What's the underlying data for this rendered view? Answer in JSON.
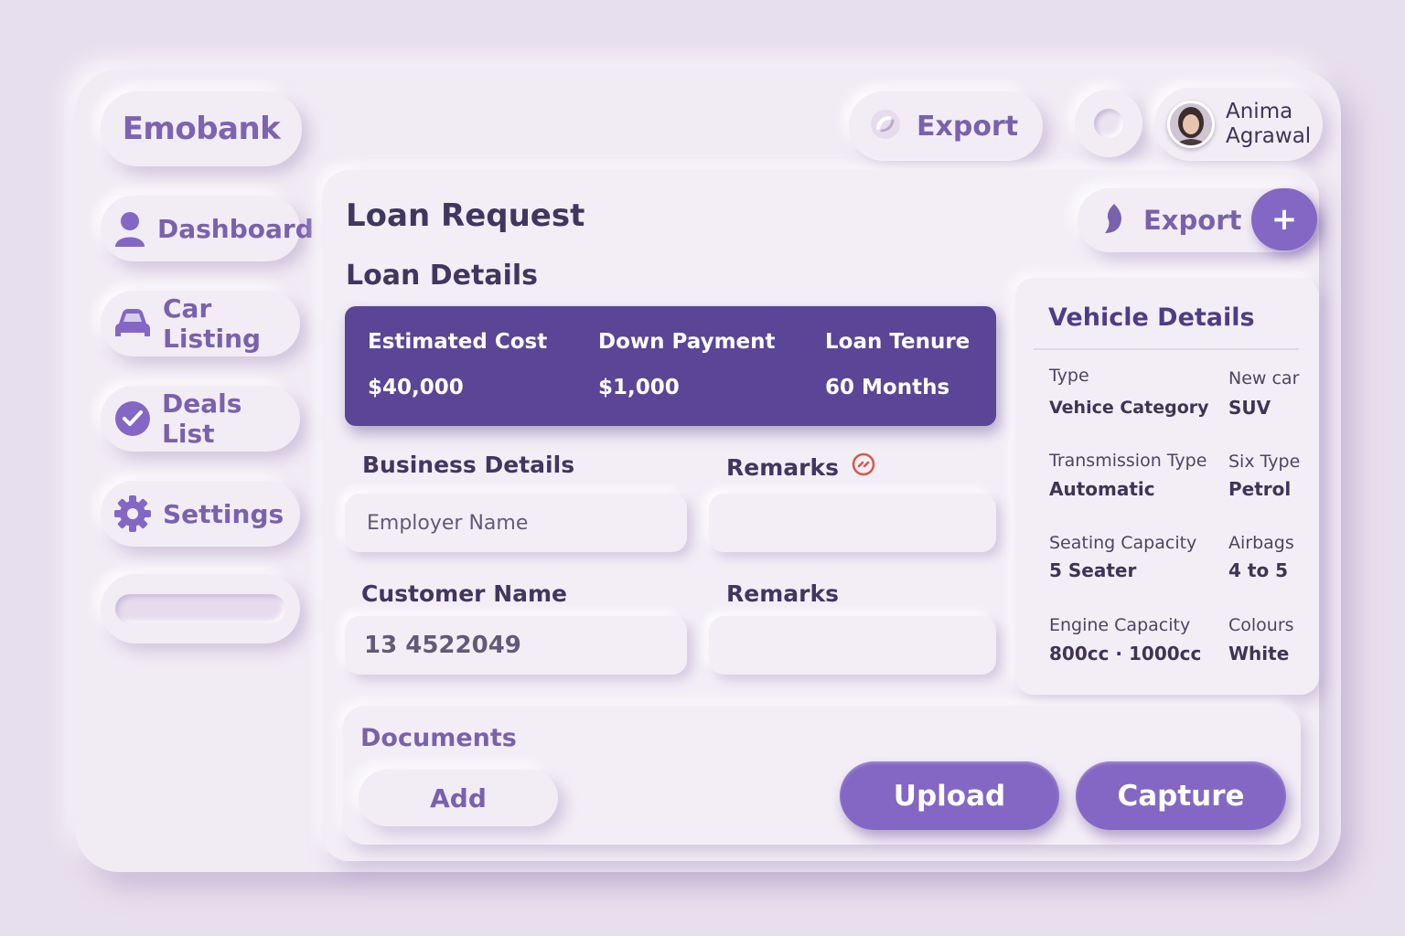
{
  "brand": {
    "name": "Emobank"
  },
  "sidebar": {
    "items": [
      {
        "label": "Dashboard",
        "icon": "user-icon"
      },
      {
        "label": "Car Listing",
        "icon": "car-icon"
      },
      {
        "label": "Deals List",
        "icon": "check-circle-icon"
      },
      {
        "label": "Settings",
        "icon": "gear-icon"
      }
    ]
  },
  "topbar": {
    "export_label": "Export",
    "user": {
      "first_name": "Anima",
      "last_name": "Agrawal"
    }
  },
  "main": {
    "title": "Loan Request",
    "export_label": "Export",
    "add_label": "+",
    "section_title": "Loan Details"
  },
  "loan_details": {
    "estimated_cost": {
      "label": "Estimated Cost",
      "value": "$40,000"
    },
    "down_payment": {
      "label": "Down Payment",
      "value": "$1,000"
    },
    "loan_tenure": {
      "label": "Loan Tenure",
      "value": "60 Months"
    }
  },
  "form": {
    "business_details_label": "Business Details",
    "employer_placeholder": "Employer Name",
    "remarks_label_1": "Remarks",
    "remarks_value_1": "",
    "customer_name_label": "Customer Name",
    "customer_name_value": "13 4522049",
    "remarks_label_2": "Remarks",
    "remarks_value_2": ""
  },
  "vehicle": {
    "title": "Vehicle Details",
    "rows": [
      {
        "left_key": "Type",
        "left_value": "Vehice Category",
        "right_key": "New car",
        "right_value": "SUV"
      },
      {
        "left_key": "Transmission Type",
        "left_value": "Automatic",
        "right_key": "Six Type",
        "right_value": "Petrol"
      },
      {
        "left_key": "Seating Capacity",
        "left_value": "5 Seater",
        "right_key": "Airbags",
        "right_value": "4 to 5"
      },
      {
        "left_key": "Engine Capacity",
        "left_value": "800cc · 1000cc",
        "right_key": "Colours",
        "right_value": "White"
      }
    ]
  },
  "documents": {
    "title": "Documents",
    "add_label": "Add",
    "upload_label": "Upload",
    "capture_label": "Capture"
  },
  "colors": {
    "accent": "#8467c4",
    "card": "#5a4597",
    "background": "#e8dfee"
  }
}
